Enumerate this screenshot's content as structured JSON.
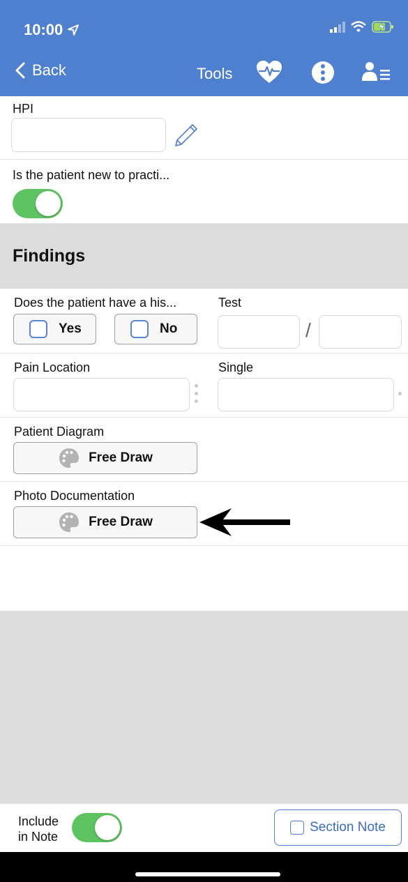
{
  "status": {
    "time": "10:00"
  },
  "nav": {
    "back_label": "Back",
    "tools_label": "Tools"
  },
  "hpi": {
    "label": "HPI",
    "value": ""
  },
  "new_patient": {
    "label": "Is the patient new to practi...",
    "toggle_on": true
  },
  "findings": {
    "title": "Findings"
  },
  "history": {
    "label": "Does the patient have a his...",
    "yes_label": "Yes",
    "no_label": "No"
  },
  "test": {
    "label": "Test",
    "separator": "/",
    "value_left": "",
    "value_right": ""
  },
  "pain_location": {
    "label": "Pain Location",
    "value": ""
  },
  "single": {
    "label": "Single",
    "value": ""
  },
  "patient_diagram": {
    "label": "Patient Diagram",
    "button_label": "Free Draw"
  },
  "photo_documentation": {
    "label": "Photo Documentation",
    "button_label": "Free Draw"
  },
  "footer": {
    "include_line1": "Include",
    "include_line2": "in Note",
    "include_toggle_on": true,
    "section_note_label": "Section Note"
  },
  "colors": {
    "header": "#4f7fcf",
    "toggle": "#5ec461",
    "grey_band": "#dcdcdc"
  }
}
